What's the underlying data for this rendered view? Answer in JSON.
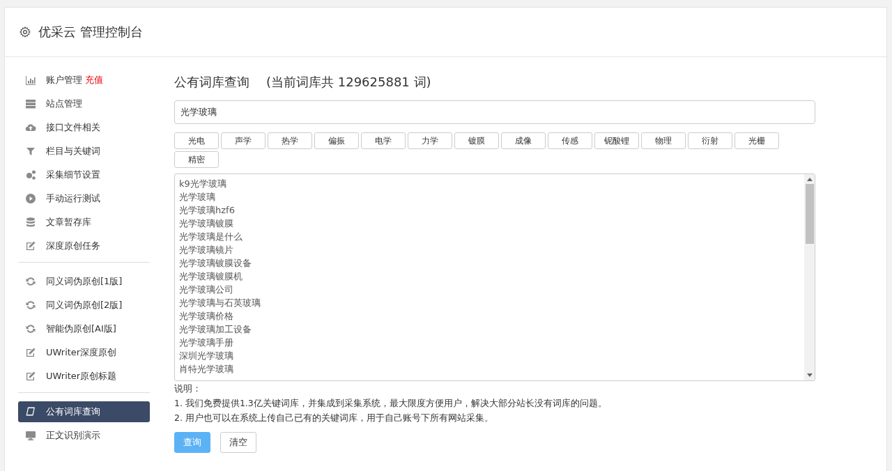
{
  "header": {
    "title": "优采云 管理控制台"
  },
  "sidebar": {
    "groups": [
      {
        "items": [
          {
            "label": "账户管理",
            "badge": "充值",
            "selected": false
          },
          {
            "label": "站点管理",
            "selected": false
          },
          {
            "label": "接口文件相关",
            "selected": false
          },
          {
            "label": "栏目与关键词",
            "selected": false
          },
          {
            "label": "采集细节设置",
            "selected": false
          },
          {
            "label": "手动运行测试",
            "selected": false
          },
          {
            "label": "文章暂存库",
            "selected": false
          },
          {
            "label": "深度原创任务",
            "selected": false
          }
        ]
      },
      {
        "items": [
          {
            "label": "同义词伪原创[1版]",
            "selected": false
          },
          {
            "label": "同义词伪原创[2版]",
            "selected": false
          },
          {
            "label": "智能伪原创[AI版]",
            "selected": false
          },
          {
            "label": "UWriter深度原创",
            "selected": false
          },
          {
            "label": "UWriter原创标题",
            "selected": false
          }
        ]
      },
      {
        "items": [
          {
            "label": "公有词库查询",
            "selected": true
          },
          {
            "label": "正文识别演示",
            "selected": false
          }
        ]
      }
    ]
  },
  "main": {
    "title": "公有词库查询",
    "subtitle": "(当前词库共 129625881 词)",
    "search": {
      "value": "光学玻璃"
    },
    "tags": [
      "光电",
      "声学",
      "热学",
      "偏振",
      "电学",
      "力学",
      "镀膜",
      "成像",
      "传感",
      "铌酸锂",
      "物理",
      "衍射",
      "光栅",
      "精密"
    ],
    "results": [
      "k9光学玻璃",
      "光学玻璃",
      "光学玻璃hzf6",
      "光学玻璃镀膜",
      "光学玻璃是什么",
      "光学玻璃镜片",
      "光学玻璃镀膜设备",
      "光学玻璃镀膜机",
      "光学玻璃公司",
      "光学玻璃与石英玻璃",
      "光学玻璃价格",
      "光学玻璃加工设备",
      "光学玻璃手册",
      "深圳光学玻璃",
      "肖特光学玻璃"
    ],
    "notes_title": "说明：",
    "notes": [
      "1. 我们免费提供1.3亿关键词库，并集成到采集系统，最大限度方便用户，解决大部分站长没有词库的问题。",
      "2. 用户也可以在系统上传自己已有的关键词库，用于自己账号下所有网站采集。"
    ],
    "buttons": [
      {
        "label": "查询",
        "kind": "primary"
      },
      {
        "label": "清空",
        "kind": "default"
      }
    ]
  }
}
